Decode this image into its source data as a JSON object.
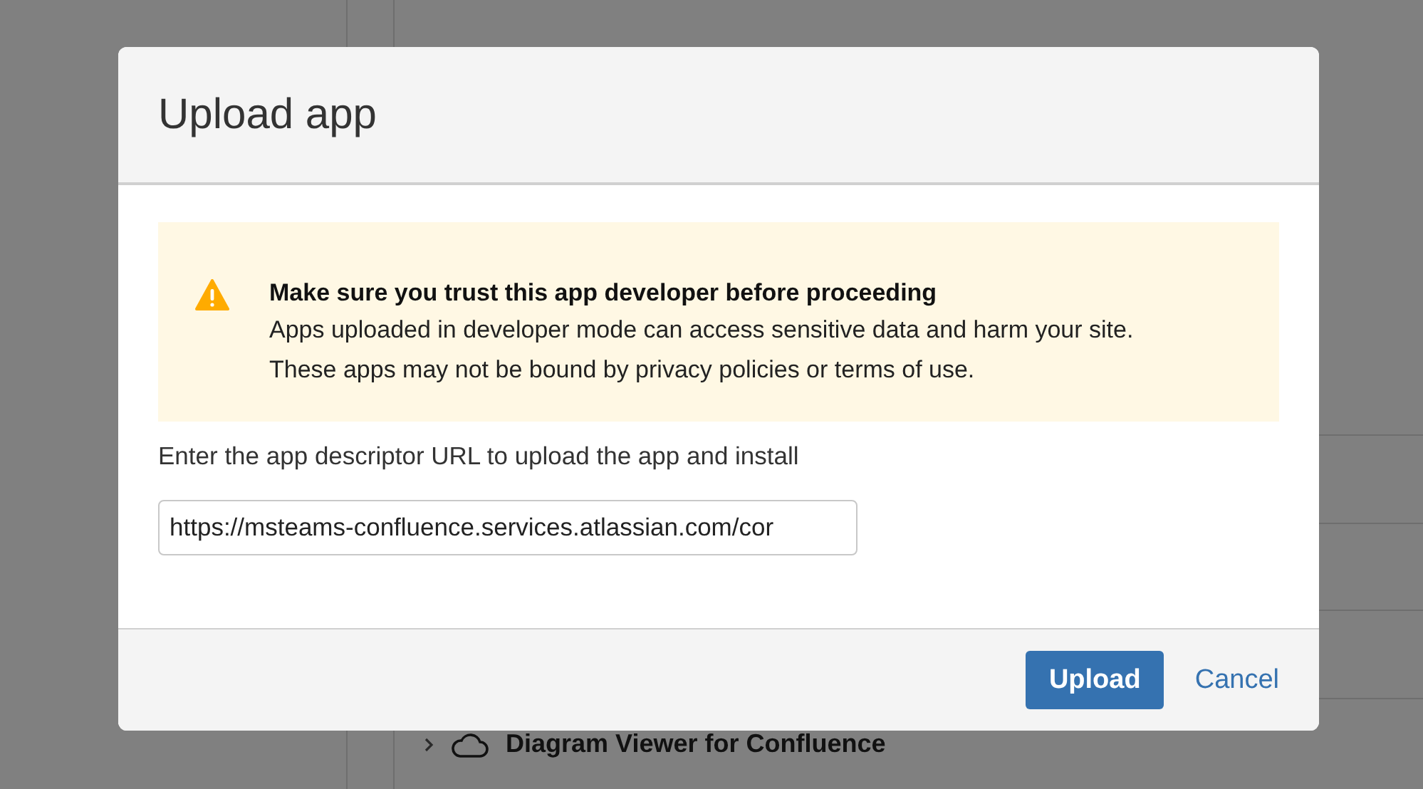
{
  "background_list": [
    {
      "title": "Diagram Viewer for Confluence",
      "expanded": false
    }
  ],
  "dialog": {
    "title": "Upload app",
    "warning": {
      "title": "Make sure you trust this app developer before proceeding",
      "body": "Apps uploaded in developer mode can access sensitive data and harm your site. These apps may not be bound by privacy policies or terms of use."
    },
    "url_label": "Enter the app descriptor URL to upload the app and install",
    "url_field": {
      "value": "https://msteams-confluence.services.atlassian.com/cor"
    },
    "buttons": [
      {
        "label": "Upload",
        "kind": "primary"
      },
      {
        "label": "Cancel",
        "kind": "link"
      }
    ]
  }
}
